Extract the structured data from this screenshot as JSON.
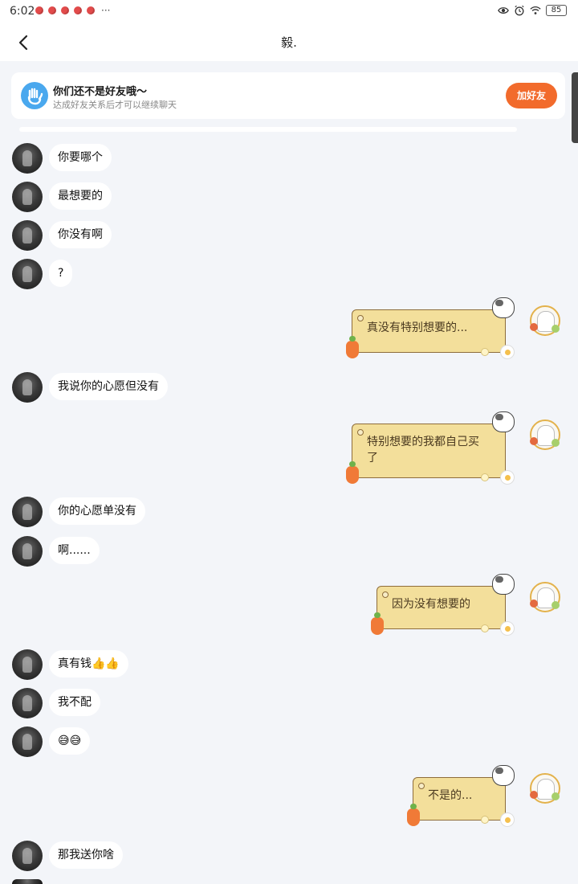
{
  "status_bar": {
    "time": "6:02",
    "more": "···",
    "battery": "85"
  },
  "header": {
    "title": "毅."
  },
  "banner": {
    "title": "你们还不是好友哦～",
    "subtitle": "达成好友关系后才可以继续聊天",
    "button_label": "加好友"
  },
  "messages": [
    {
      "side": "in",
      "text": "你要哪个"
    },
    {
      "side": "in",
      "text": "最想要的"
    },
    {
      "side": "in",
      "text": "你没有啊"
    },
    {
      "side": "in",
      "text": "?"
    },
    {
      "side": "out",
      "text": "真没有特别想要的..."
    },
    {
      "side": "in",
      "text": "我说你的心愿但没有"
    },
    {
      "side": "out",
      "text": "特别想要的我都自己买了"
    },
    {
      "side": "in",
      "text": "你的心愿单没有"
    },
    {
      "side": "in",
      "text": "啊......"
    },
    {
      "side": "out",
      "text": "因为没有想要的"
    },
    {
      "side": "in",
      "text": "真有钱👍👍"
    },
    {
      "side": "in",
      "text": "我不配"
    },
    {
      "side": "in",
      "text": "😅😅"
    },
    {
      "side": "out",
      "text": "不是的..."
    },
    {
      "side": "in",
      "text": "那我送你啥"
    }
  ]
}
